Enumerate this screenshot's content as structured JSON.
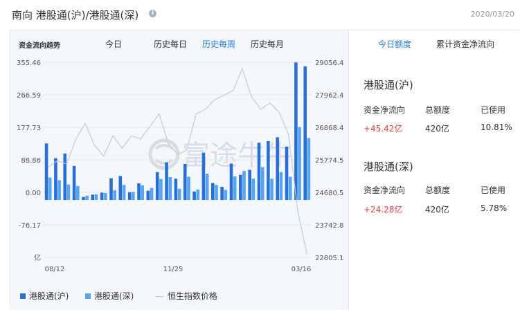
{
  "header": {
    "title": "南向 港股通(沪)/港股通(深)",
    "info_icon": "info-icon",
    "date": "2020/03/20"
  },
  "chart_panel": {
    "label": "资金流向趋势",
    "tabs": [
      "今日",
      "历史每日",
      "历史每周",
      "历史每月"
    ],
    "active_tab": "历史每周",
    "watermark": "富途牛牛"
  },
  "colors": {
    "accent": "#2a7de1",
    "series_sh": "#2a6fd6",
    "series_sz": "#55a6f2",
    "series_index": "#c7cbd1",
    "positive": "#e84141"
  },
  "chart_data": {
    "type": "bar",
    "x_tick_labels": [
      "08/12",
      "11/25",
      "03/16"
    ],
    "y_left_ticks": [
      "355.46",
      "266.59",
      "177.73",
      "88.86",
      "0.00",
      "-76.17",
      "亿"
    ],
    "y_left_range": [
      -148.1,
      355.46
    ],
    "y_right_ticks": [
      "29056.4",
      "27962.4",
      "26868.4",
      "25774.5",
      "24680.5",
      "23742.8",
      "22805.1"
    ],
    "y_right_range": [
      22805.1,
      29056.4
    ],
    "series": [
      {
        "name": "港股通(沪)",
        "type": "bar",
        "values": [
          146,
          108,
          120,
          88,
          8,
          14,
          19,
          56,
          62,
          20,
          43,
          24,
          72,
          97,
          55,
          93,
          22,
          122,
          44,
          34,
          94,
          65,
          78,
          148,
          152,
          162,
          138,
          355,
          345
        ]
      },
      {
        "name": "港股通(深)",
        "type": "bar",
        "values": [
          58,
          51,
          40,
          36,
          11,
          15,
          18,
          25,
          39,
          21,
          38,
          31,
          54,
          59,
          29,
          60,
          27,
          68,
          39,
          26,
          61,
          75,
          55,
          85,
          55,
          72,
          60,
          188,
          160
        ]
      },
      {
        "name": "恒生指数价格",
        "type": "line",
        "values": [
          25700,
          25900,
          25800,
          26600,
          27100,
          26400,
          26050,
          26700,
          26300,
          26700,
          26600,
          27000,
          27400,
          26450,
          26100,
          26250,
          27400,
          27550,
          27850,
          28000,
          28150,
          28850,
          27950,
          27550,
          27750,
          27450,
          26750,
          24300,
          22900
        ]
      }
    ]
  },
  "right_panel": {
    "tabs": [
      "今日额度",
      "累计资金净流向"
    ],
    "active_tab": "今日额度",
    "sections": [
      {
        "title": "港股通(沪)",
        "headers": [
          "资金净流向",
          "总额度",
          "已使用"
        ],
        "values": [
          "+45.42亿",
          "420亿",
          "10.81%"
        ]
      },
      {
        "title": "港股通(深)",
        "headers": [
          "资金净流向",
          "总额度",
          "已使用"
        ],
        "values": [
          "+24.28亿",
          "420亿",
          "5.78%"
        ]
      }
    ]
  }
}
